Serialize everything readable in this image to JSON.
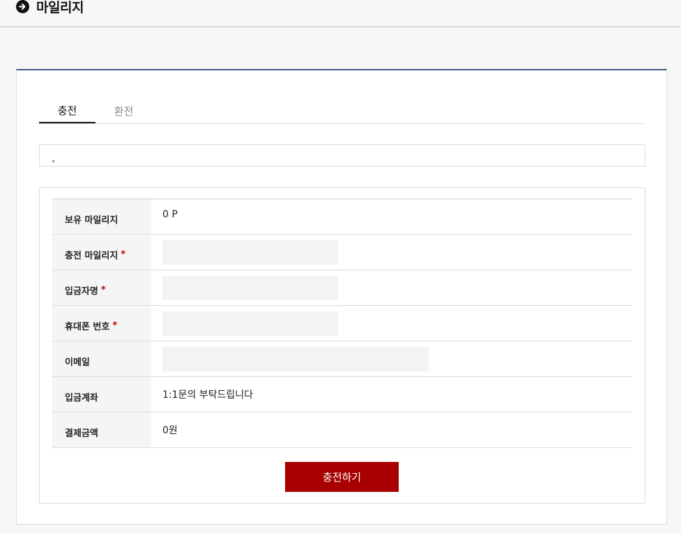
{
  "header": {
    "title": "마일리지",
    "icon": "arrow-right-circle-icon"
  },
  "tabs": [
    {
      "label": "충전",
      "active": true
    },
    {
      "label": "환전",
      "active": false
    }
  ],
  "form": {
    "rows": {
      "balance": {
        "label": "보유 마일리지",
        "value": "0 P"
      },
      "charge": {
        "label": "충전 마일리지",
        "required_mark": "*",
        "value": ""
      },
      "depositor": {
        "label": "입금자명",
        "required_mark": "*",
        "value": ""
      },
      "phone": {
        "label": "휴대폰 번호",
        "required_mark": "*",
        "value": ""
      },
      "email": {
        "label": "이메일",
        "value": ""
      },
      "account": {
        "label": "입금계좌",
        "value": "1:1문의 부탁드립니다"
      },
      "amount": {
        "label": "결제금액",
        "value": "0원"
      }
    },
    "submit_label": "충전하기"
  },
  "colors": {
    "accent_border": "#3e5b86",
    "submit_bg": "#a80000",
    "required": "#c00000"
  }
}
